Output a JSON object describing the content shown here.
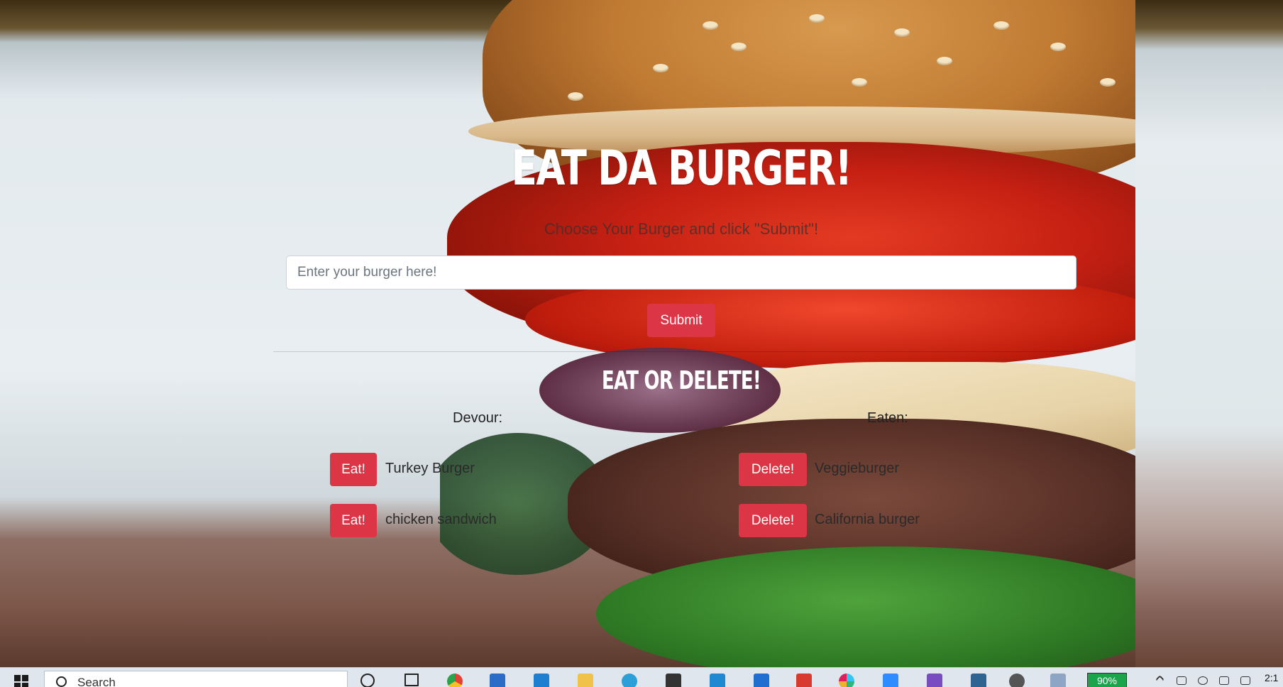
{
  "page": {
    "title": "Eat Da Burger!",
    "subtitle": "Choose Your Burger and click \"Submit\"!",
    "input_placeholder": "Enter your burger here!",
    "submit_label": "Submit",
    "section_title": "Eat or Delete!",
    "devour_label": "Devour:",
    "eaten_label": "Eaten:"
  },
  "devour": [
    {
      "name": "Turkey Burger",
      "button": "Eat!"
    },
    {
      "name": "chicken sandwich",
      "button": "Eat!"
    }
  ],
  "eaten": [
    {
      "name": "Veggieburger",
      "button": "Delete!"
    },
    {
      "name": "California burger",
      "button": "Delete!"
    }
  ],
  "taskbar": {
    "search_label": "Search",
    "battery": "90%",
    "clock": "2:1"
  },
  "colors": {
    "button_red": "#dc3545",
    "heading_white": "#ffffff"
  },
  "icons": [
    "windows-start-icon",
    "search-icon",
    "cortana-icon",
    "task-view-icon",
    "chrome-icon",
    "mail-icon",
    "vscode-icon",
    "file-explorer-icon",
    "edge-icon",
    "briefcase-icon",
    "app-icon",
    "photo-icon",
    "gmail-icon",
    "slack-icon",
    "zoom-icon",
    "github-desktop-icon",
    "mysql-icon",
    "settings-icon",
    "notes-icon",
    "battery-icon"
  ]
}
